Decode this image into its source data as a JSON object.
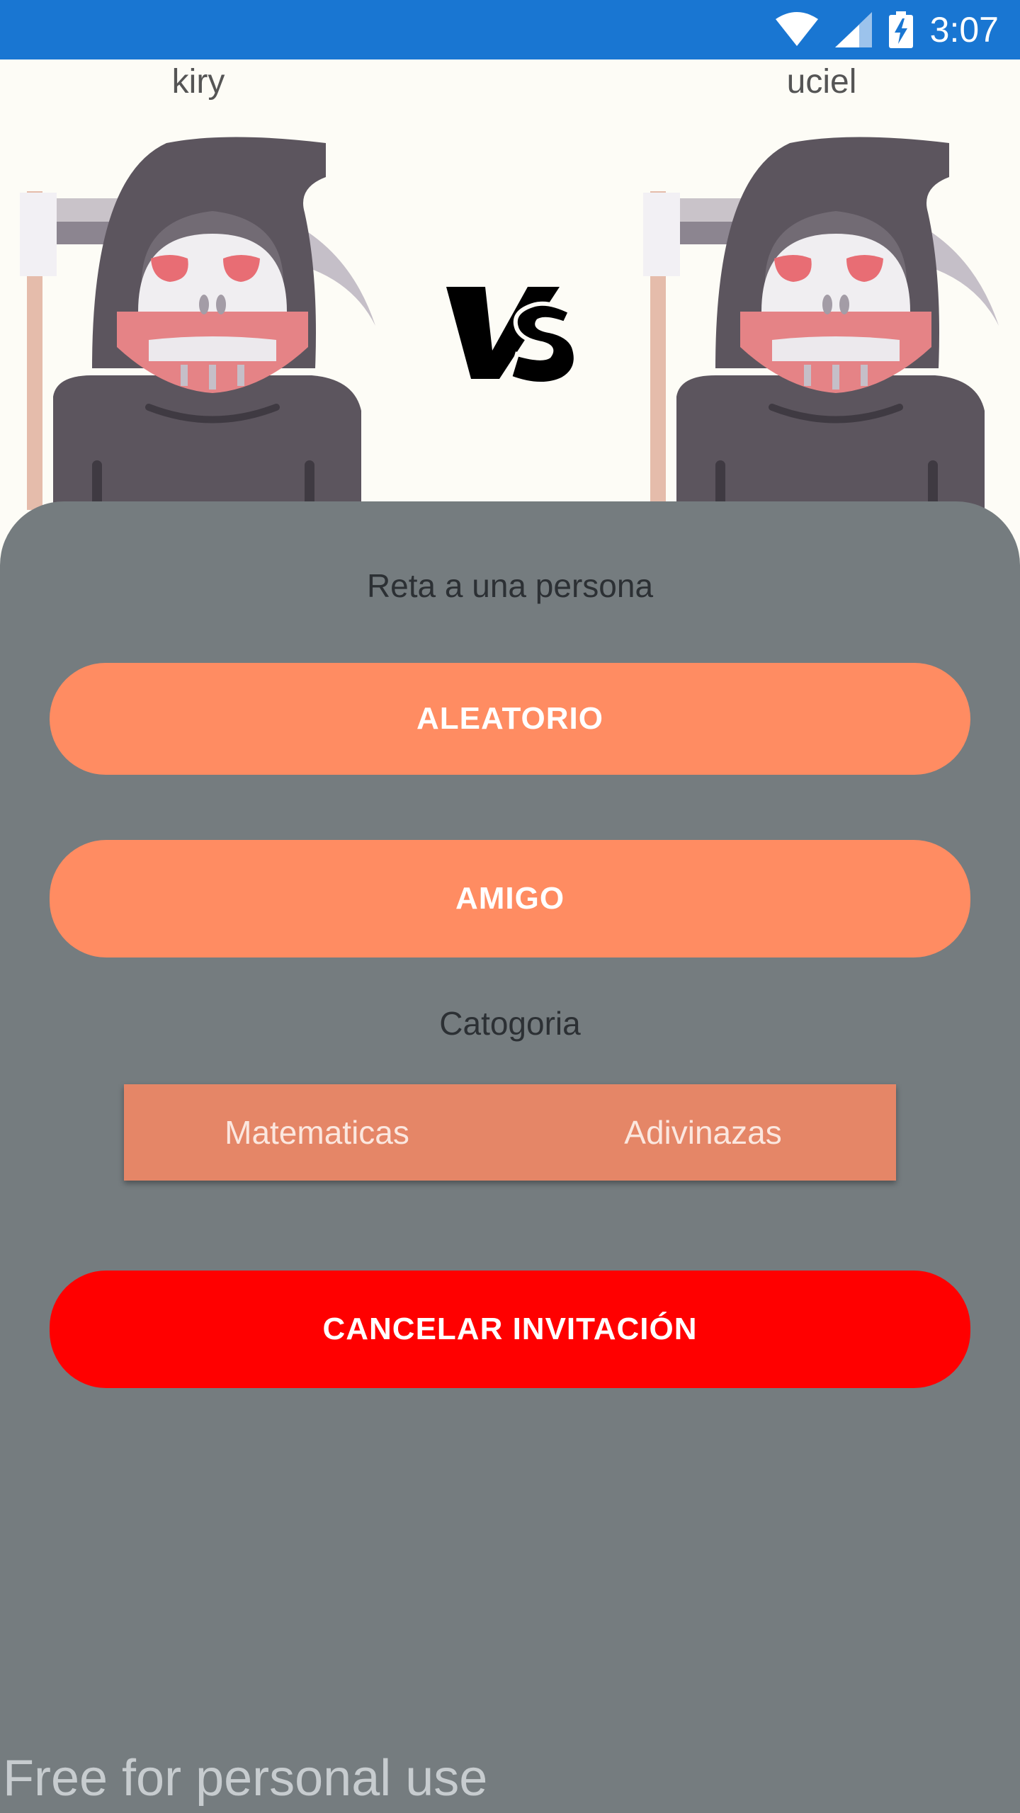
{
  "status_bar": {
    "time": "3:07",
    "icons": [
      "wifi-icon",
      "cell-signal-icon",
      "battery-charging-icon"
    ],
    "background": "#1976d2"
  },
  "players": {
    "left": {
      "name": "kiry",
      "avatar": "grim-reaper-icon"
    },
    "right": {
      "name": "uciel",
      "avatar": "grim-reaper-icon"
    }
  },
  "versus": {
    "logo": "vs-logo"
  },
  "sheet": {
    "title": "Reta a una persona",
    "random_button": "ALEATORIO",
    "friend_button": "AMIGO",
    "category_label": "Catogoria",
    "categories": [
      "Matematicas",
      "Adivinazas"
    ],
    "cancel_button": "CANCELAR INVITACIÓN"
  },
  "watermark": "Free for personal use",
  "colors": {
    "sheet_bg": "#757c7f",
    "accent_button": "#ff8c62",
    "segment_bg": "#e58667",
    "cancel_button": "#ff0000"
  }
}
